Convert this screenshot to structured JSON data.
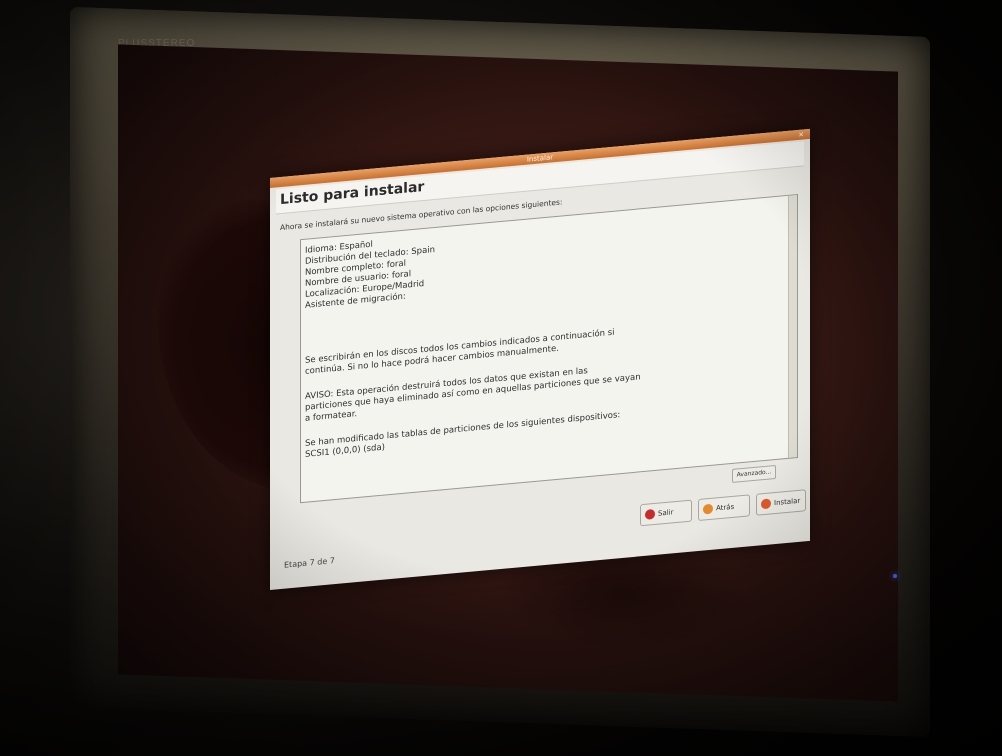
{
  "monitor": {
    "brand": "PLUSSTEREO"
  },
  "window": {
    "title": "Instalar",
    "close_glyph": "×"
  },
  "heading": "Listo para instalar",
  "intro": "Ahora se instalará su nuevo sistema operativo con las opciones siguientes:",
  "summary": {
    "lines": [
      "Idioma: Español",
      "Distribución del teclado: Spain",
      "Nombre completo: foral",
      "Nombre de usuario: foral",
      "Localización: Europe/Madrid",
      "Asistente de migración:",
      "",
      "",
      "",
      "",
      "Se escribirán en los discos todos los cambios indicados a continuación si",
      "continúa. Si no lo hace podrá hacer cambios manualmente.",
      "",
      "AVISO: Esta operación destruirá todos los datos que existan en las",
      "particiones que haya eliminado así como en aquellas particiones que se vayan",
      "a formatear.",
      "",
      "Se han modificado las tablas de particiones de los siguientes dispositivos:",
      "SCSI1 (0,0,0) (sda)"
    ]
  },
  "buttons": {
    "advanced": "Avanzado...",
    "quit": "Salir",
    "back": "Atrás",
    "install": "Instalar"
  },
  "step": "Etapa 7 de 7"
}
